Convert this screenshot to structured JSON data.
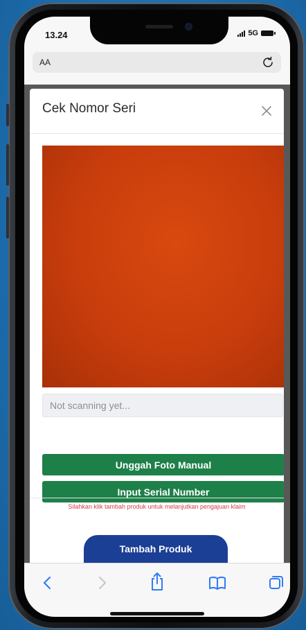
{
  "status_bar": {
    "time": "13.24",
    "network": "5G"
  },
  "browser": {
    "aa_label": "AA",
    "reload_icon": "reload-icon"
  },
  "modal": {
    "title": "Cek Nomor Seri",
    "close_icon": "close-icon",
    "scan_status": "Not scanning yet...",
    "upload_button": "Unggah Foto Manual",
    "serial_button": "Input Serial Number",
    "hint": "Silahkan klik tambah produk untuk melanjutkan pengajuan klaim",
    "add_product_button": "Tambah Produk"
  },
  "toolbar": {
    "icons": [
      "back-icon",
      "forward-icon",
      "share-icon",
      "bookmarks-icon",
      "tabs-icon"
    ]
  },
  "colors": {
    "primary_green": "#1e8049",
    "primary_blue": "#1b3f95",
    "hint_red": "#d0404a",
    "ios_blue": "#2f7cf6"
  }
}
